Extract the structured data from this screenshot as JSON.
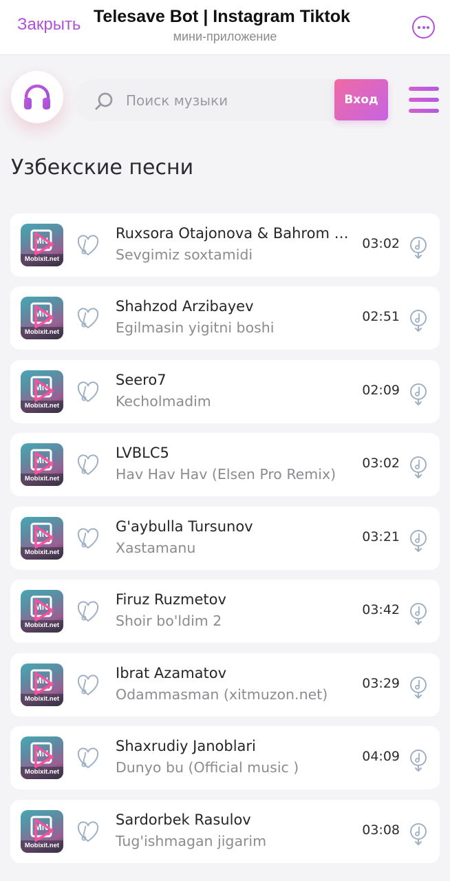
{
  "header": {
    "close_label": "Закрыть",
    "title": "Telesave Bot | Instagram Tiktok",
    "subtitle": "мини-приложение",
    "more_icon": "more-horizontal-icon"
  },
  "topbar": {
    "logo_icon": "headphones-icon",
    "search_placeholder": "Поиск музыки",
    "search_value": "",
    "search_icon": "search-icon",
    "login_label": "Вход",
    "menu_icon": "menu-icon"
  },
  "section": {
    "title": "Узбекские песни"
  },
  "tracks": [
    {
      "artist": "Ruxsora Otajonova & Bahrom Nazarov",
      "title": "Sevgimiz soxtamidi",
      "duration": "03:02",
      "cover_label": "Mobixit.net"
    },
    {
      "artist": "Shahzod Arzibayev",
      "title": "Egilmasin yigitni boshi",
      "duration": "02:51",
      "cover_label": "Mobixit.net"
    },
    {
      "artist": "Seero7",
      "title": "Kecholmadim",
      "duration": "02:09",
      "cover_label": "Mobixit.net"
    },
    {
      "artist": "LVBLC5",
      "title": "Hav Hav Hav (Elsen Pro Remix)",
      "duration": "03:02",
      "cover_label": "Mobixit.net"
    },
    {
      "artist": "G'aybulla Tursunov",
      "title": "Xastamanu",
      "duration": "03:21",
      "cover_label": "Mobixit.net"
    },
    {
      "artist": "Firuz Ruzmetov",
      "title": "Shoir bo'ldim 2",
      "duration": "03:42",
      "cover_label": "Mobixit.net"
    },
    {
      "artist": "Ibrat Azamatov",
      "title": "Odammasman (xitmuzon.net)",
      "duration": "03:29",
      "cover_label": "Mobixit.net"
    },
    {
      "artist": "Shaxrudiy Janoblari",
      "title": "Dunyo bu (Official music )",
      "duration": "04:09",
      "cover_label": "Mobixit.net"
    },
    {
      "artist": "Sardorbek Rasulov",
      "title": "Tug'ishmagan jigarim",
      "duration": "03:08",
      "cover_label": "Mobixit.net"
    }
  ],
  "colors": {
    "accent": "#b150d8",
    "gradient_start": "#f06aa3",
    "gradient_end": "#c664e2",
    "icon_gray": "#9fb0c4"
  }
}
